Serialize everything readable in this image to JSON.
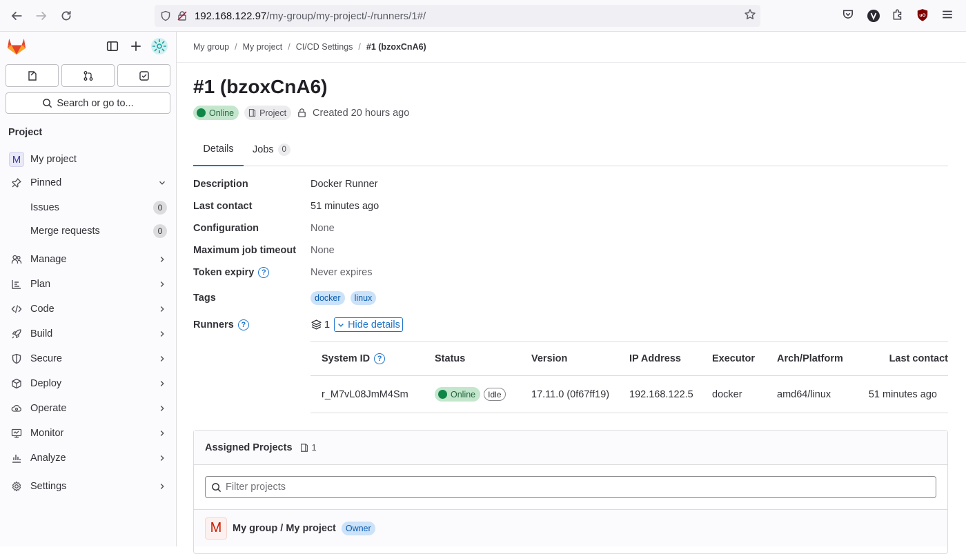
{
  "browser": {
    "url_host": "192.168.122.97",
    "url_path": "/my-group/my-project/-/runners/1#/"
  },
  "sidebar": {
    "search_label": "Search or go to...",
    "section_heading": "Project",
    "project_initial": "M",
    "project_name": "My project",
    "pinned_label": "Pinned",
    "pinned_items": [
      {
        "label": "Issues",
        "count": "0"
      },
      {
        "label": "Merge requests",
        "count": "0"
      }
    ],
    "nav_items": [
      {
        "label": "Manage",
        "icon": "users-icon"
      },
      {
        "label": "Plan",
        "icon": "planning-icon"
      },
      {
        "label": "Code",
        "icon": "code-icon"
      },
      {
        "label": "Build",
        "icon": "rocket-icon"
      },
      {
        "label": "Secure",
        "icon": "shield-icon"
      },
      {
        "label": "Deploy",
        "icon": "deploy-icon"
      },
      {
        "label": "Operate",
        "icon": "cloud-gear-icon"
      },
      {
        "label": "Monitor",
        "icon": "monitor-icon"
      },
      {
        "label": "Analyze",
        "icon": "chart-icon"
      },
      {
        "label": "Settings",
        "icon": "gear-icon"
      }
    ]
  },
  "breadcrumb": [
    "My group",
    "My project",
    "CI/CD Settings",
    "#1 (bzoxCnA6)"
  ],
  "page": {
    "title": "#1 (bzoxCnA6)",
    "status": "Online",
    "type": "Project",
    "created": "Created 20 hours ago"
  },
  "tabs": [
    {
      "label": "Details"
    },
    {
      "label": "Jobs",
      "count": "0"
    }
  ],
  "details": {
    "description_label": "Description",
    "description": "Docker Runner",
    "last_contact_label": "Last contact",
    "last_contact": "51 minutes ago",
    "configuration_label": "Configuration",
    "configuration": "None",
    "timeout_label": "Maximum job timeout",
    "timeout": "None",
    "token_label": "Token expiry",
    "token": "Never expires",
    "tags_label": "Tags",
    "tags": [
      "docker",
      "linux"
    ],
    "runners_label": "Runners",
    "runners_count": "1",
    "hide_details": "Hide details"
  },
  "runners_table": {
    "headers": [
      "System ID",
      "Status",
      "Version",
      "IP Address",
      "Executor",
      "Arch/Platform",
      "Last contact"
    ],
    "rows": [
      {
        "system_id": "r_M7vL08JmM4Sm",
        "status": "Online",
        "state": "Idle",
        "version": "17.11.0 (0f67ff19)",
        "ip": "192.168.122.5",
        "executor": "docker",
        "arch": "amd64/linux",
        "last_contact": "51 minutes ago"
      }
    ]
  },
  "assigned": {
    "title": "Assigned Projects",
    "count": "1",
    "filter_placeholder": "Filter projects",
    "project_initial": "M",
    "project_name": "My group / My project",
    "role": "Owner"
  }
}
